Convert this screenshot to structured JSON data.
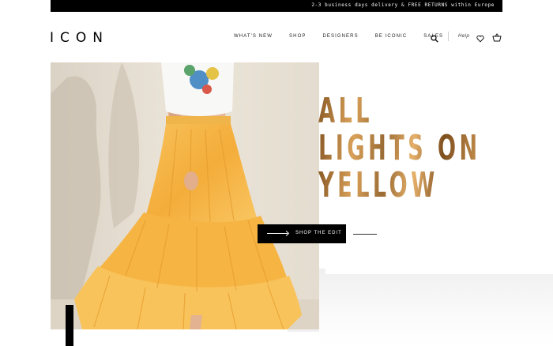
{
  "announcement": "2-3 business days delivery & FREE RETURNS within Europe",
  "brand": {
    "logo": "ICON"
  },
  "nav": {
    "items": [
      "WHAT'S NEW",
      "SHOP",
      "DESIGNERS",
      "BE ICONIC",
      "SALES"
    ],
    "help": "Help",
    "icons": [
      "search-icon",
      "heart-icon",
      "bag-icon"
    ]
  },
  "hero": {
    "headline": [
      "ALL",
      "LIGHTS ON",
      "YELLOW"
    ],
    "cta_label": "SHOP THE EDIT"
  },
  "colors": {
    "accent_gold": "#b27a2e",
    "skirt_yellow": "#f5b545",
    "wall_beige": "#e9e1d4"
  }
}
